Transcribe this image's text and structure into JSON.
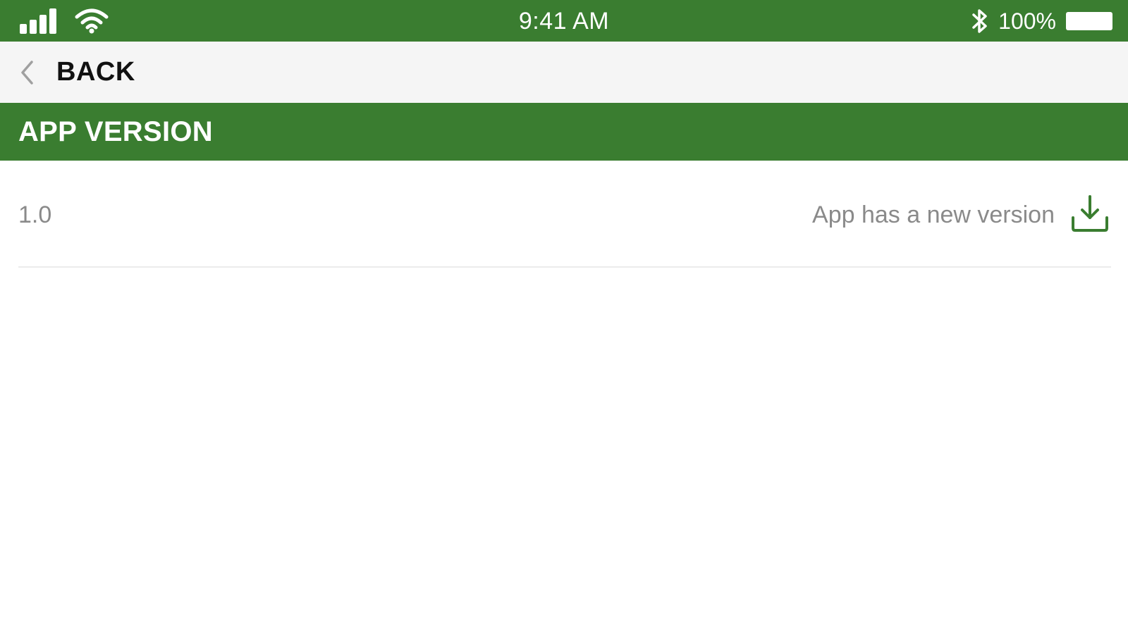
{
  "status_bar": {
    "time": "9:41 AM",
    "battery": "100%",
    "icons": [
      "signal-icon",
      "wifi-icon",
      "bluetooth-icon",
      "battery-icon"
    ]
  },
  "nav": {
    "back_label": "BACK",
    "back_icon": "chevron-left-icon"
  },
  "section": {
    "title": "APP VERSION"
  },
  "version_row": {
    "current_version": "1.0",
    "update_message": "App has a new version",
    "action_icon": "download-icon"
  },
  "colors": {
    "brand_green": "#3a7d30",
    "nav_background": "#f5f5f5",
    "muted_text": "#8a8a8a"
  }
}
